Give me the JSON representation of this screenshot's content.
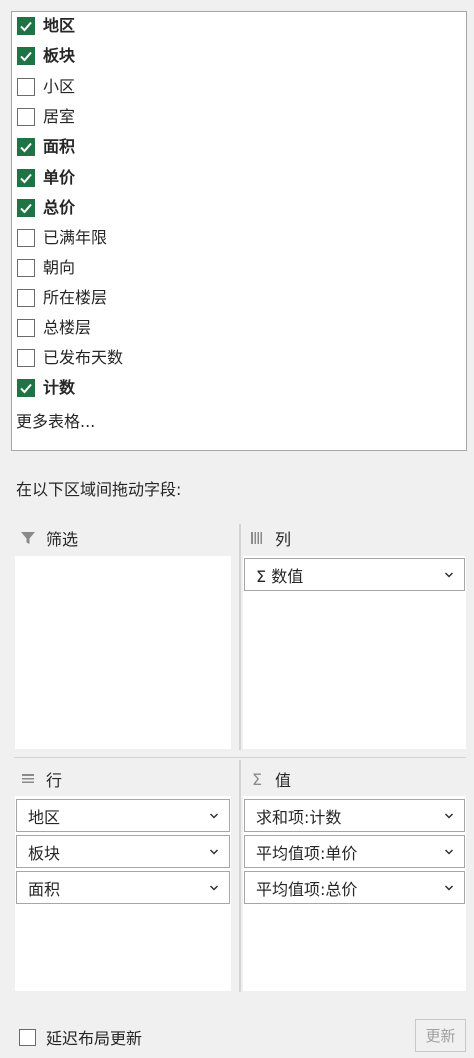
{
  "fields": [
    {
      "label": "地区",
      "checked": true
    },
    {
      "label": "板块",
      "checked": true
    },
    {
      "label": "小区",
      "checked": false
    },
    {
      "label": "居室",
      "checked": false
    },
    {
      "label": "面积",
      "checked": true
    },
    {
      "label": "单价",
      "checked": true
    },
    {
      "label": "总价",
      "checked": true
    },
    {
      "label": "已满年限",
      "checked": false
    },
    {
      "label": "朝向",
      "checked": false
    },
    {
      "label": "所在楼层",
      "checked": false
    },
    {
      "label": "总楼层",
      "checked": false
    },
    {
      "label": "已发布天数",
      "checked": false
    },
    {
      "label": "计数",
      "checked": true
    }
  ],
  "more_tables": "更多表格...",
  "drag_hint": "在以下区域间拖动字段:",
  "areas": {
    "filter": {
      "title": "筛选",
      "icon": "filter-icon",
      "items": []
    },
    "columns": {
      "title": "列",
      "icon": "columns-icon",
      "items": [
        "Σ 数值"
      ]
    },
    "rows": {
      "title": "行",
      "icon": "rows-icon",
      "items": [
        "地区",
        "板块",
        "面积"
      ]
    },
    "values": {
      "title": "值",
      "icon": "sigma-icon",
      "items": [
        "求和项:计数",
        "平均值项:单价",
        "平均值项:总价"
      ]
    }
  },
  "defer_update": {
    "label": "延迟布局更新",
    "checked": false
  },
  "update_button": "更新",
  "colors": {
    "accent": "#217346",
    "panel": "#f0f0f0",
    "border": "#a6a6a6"
  }
}
